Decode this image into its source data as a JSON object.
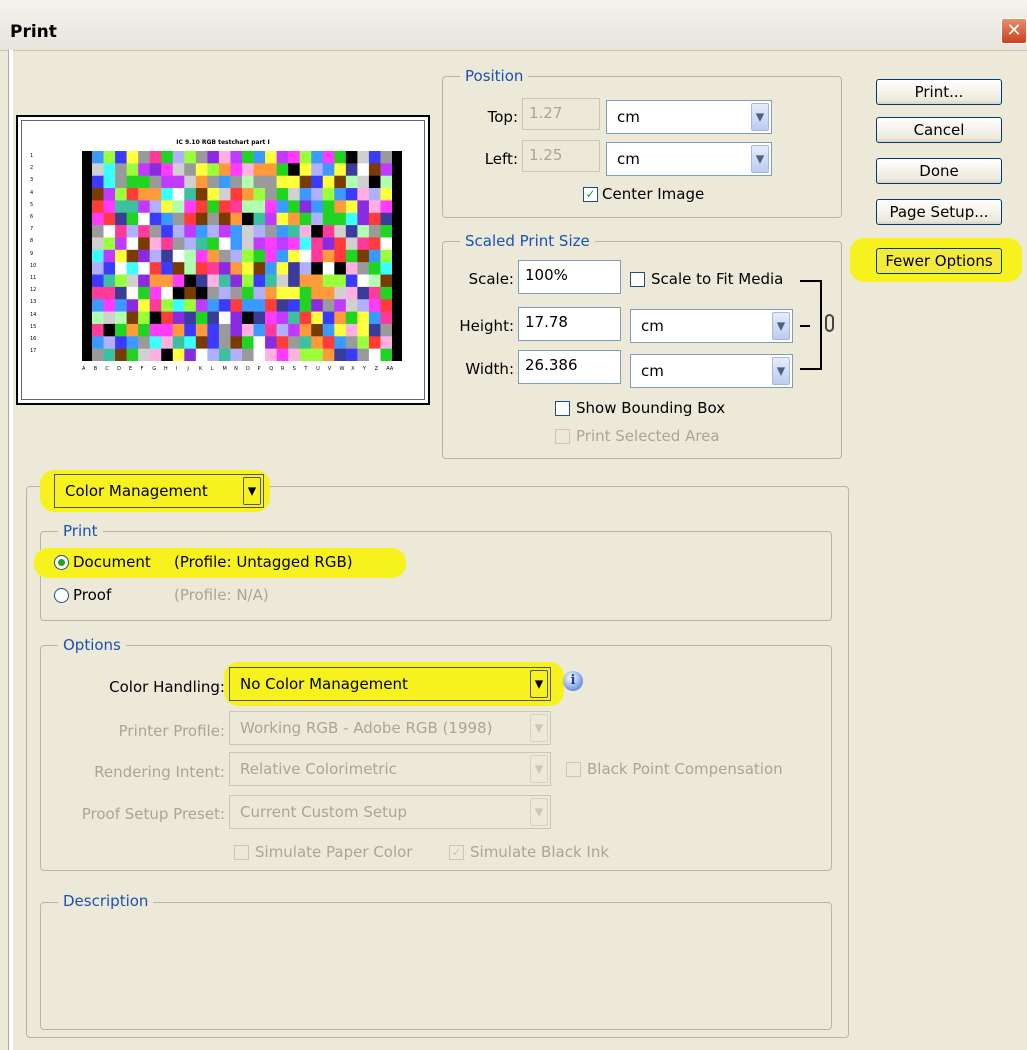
{
  "window": {
    "title": "Print",
    "close_label": "✕"
  },
  "preview": {
    "chart_title": "IC 9.10 RGB testchart part I",
    "row_labels": [
      "1",
      "2",
      "3",
      "4",
      "5",
      "6",
      "7",
      "8",
      "9",
      "10",
      "11",
      "12",
      "13",
      "14",
      "15",
      "16",
      "17"
    ],
    "col_labels": [
      "A",
      "B",
      "C",
      "D",
      "E",
      "F",
      "G",
      "H",
      "I",
      "J",
      "K",
      "L",
      "M",
      "N",
      "O",
      "P",
      "Q",
      "R",
      "S",
      "T",
      "U",
      "V",
      "W",
      "X",
      "Y",
      "Z",
      "AA"
    ]
  },
  "position": {
    "legend": "Position",
    "top_label": "Top:",
    "top_value": "1.27",
    "top_unit": "cm",
    "left_label": "Left:",
    "left_value": "1.25",
    "left_unit": "cm",
    "center_image_label": "Center Image",
    "center_image_checked": true
  },
  "scaled": {
    "legend": "Scaled Print Size",
    "scale_label": "Scale:",
    "scale_value": "100%",
    "scale_to_fit_label": "Scale to Fit Media",
    "height_label": "Height:",
    "height_value": "17.78",
    "height_unit": "cm",
    "width_label": "Width:",
    "width_value": "26.386",
    "width_unit": "cm",
    "show_bbox_label": "Show Bounding Box",
    "print_selected_label": "Print Selected Area"
  },
  "buttons": {
    "print": "Print...",
    "cancel": "Cancel",
    "done": "Done",
    "page_setup": "Page Setup...",
    "fewer_options": "Fewer Options"
  },
  "color_mgmt": {
    "dropdown_value": "Color Management",
    "print_legend": "Print",
    "document_label": "Document",
    "document_profile": "(Profile: Untagged RGB)",
    "proof_label": "Proof",
    "proof_profile": "(Profile: N/A)",
    "options_legend": "Options",
    "color_handling_label": "Color Handling:",
    "color_handling_value": "No Color Management",
    "printer_profile_label": "Printer Profile:",
    "printer_profile_value": "Working RGB - Adobe RGB (1998)",
    "rendering_intent_label": "Rendering Intent:",
    "rendering_intent_value": "Relative Colorimetric",
    "black_point_label": "Black Point Compensation",
    "proof_setup_label": "Proof Setup Preset:",
    "proof_setup_value": "Current Custom Setup",
    "simulate_paper_label": "Simulate Paper Color",
    "simulate_ink_label": "Simulate Black Ink",
    "description_legend": "Description"
  },
  "colors": {
    "highlight": "#f7f21e",
    "legend_blue": "#1a50b8",
    "dialog_bg": "#ece9d8"
  }
}
